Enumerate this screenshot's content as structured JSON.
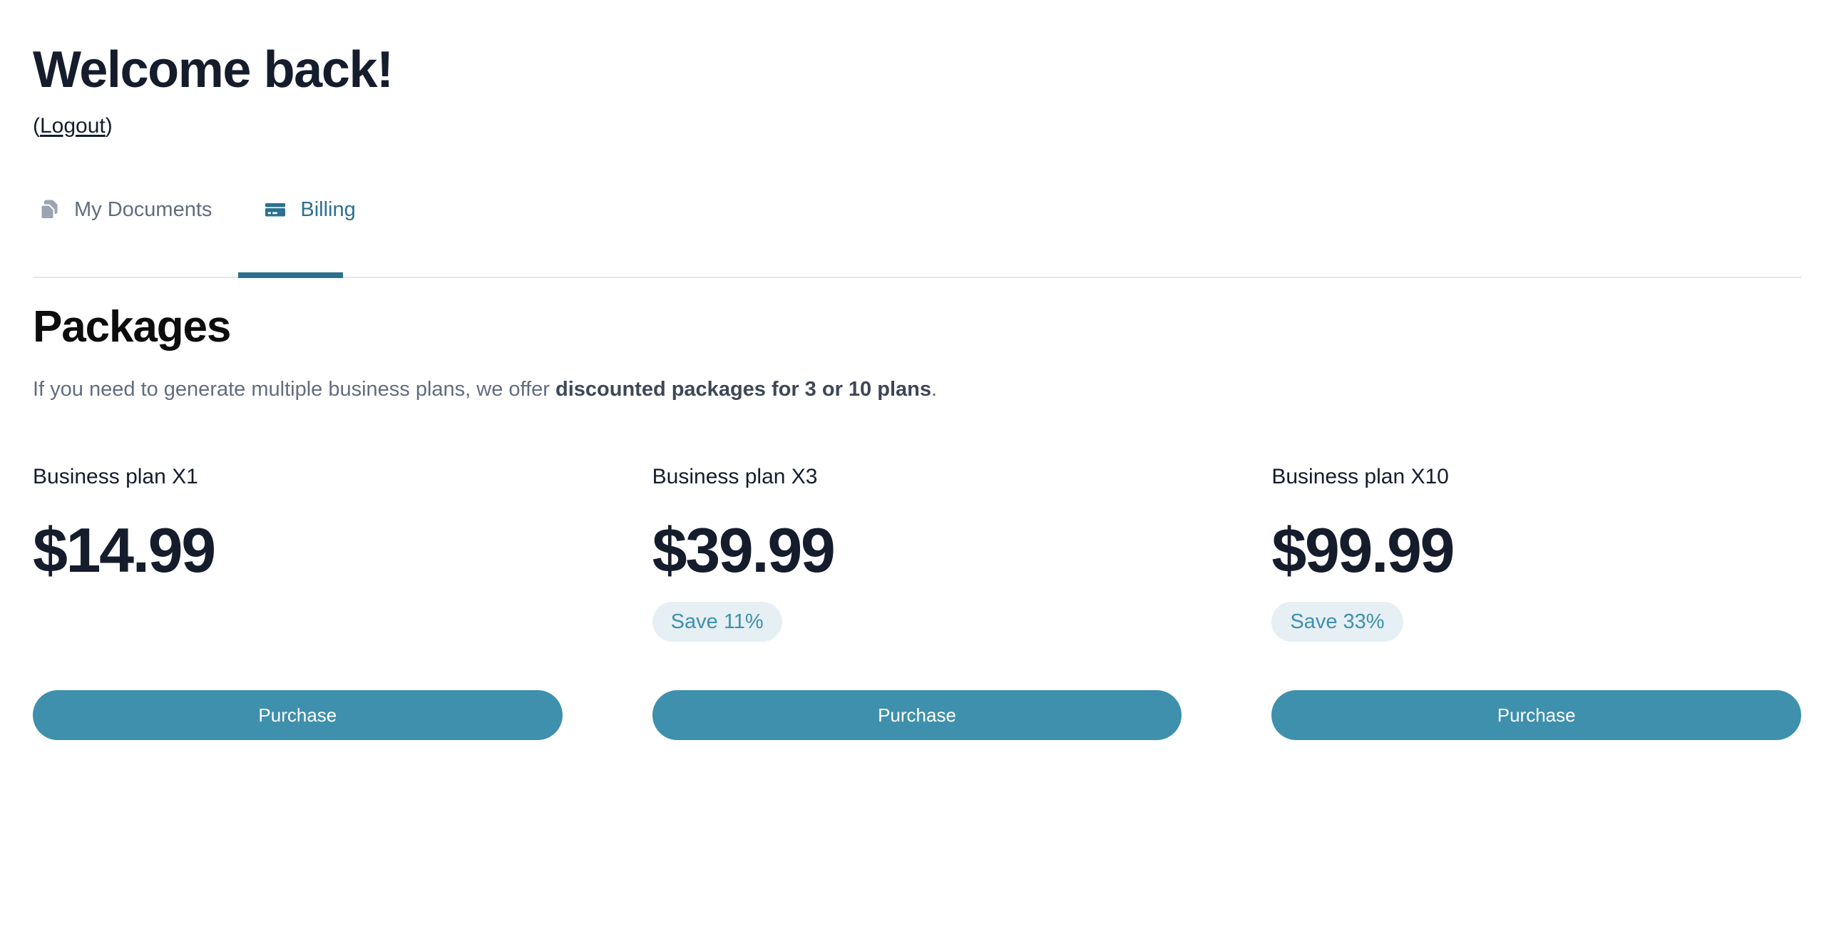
{
  "header": {
    "title": "Welcome back!",
    "logout_open_paren": "(",
    "logout_label": "Logout",
    "logout_close_paren": ")"
  },
  "tabs": [
    {
      "label": "My Documents",
      "icon": "documents-icon",
      "active": false
    },
    {
      "label": "Billing",
      "icon": "credit-card-icon",
      "active": true
    }
  ],
  "packages": {
    "title": "Packages",
    "subtitle_prefix": "If you need to generate multiple business plans, we offer ",
    "subtitle_bold": "discounted packages for 3 or 10 plans",
    "subtitle_suffix": ".",
    "plans": [
      {
        "name": "Business plan X1",
        "price": "$14.99",
        "save_badge": "",
        "button_label": "Purchase"
      },
      {
        "name": "Business plan X3",
        "price": "$39.99",
        "save_badge": "Save 11%",
        "button_label": "Purchase"
      },
      {
        "name": "Business plan X10",
        "price": "$99.99",
        "save_badge": "Save 33%",
        "button_label": "Purchase"
      }
    ]
  },
  "colors": {
    "accent": "#3e90ac",
    "accent_dark": "#2d6f8e",
    "badge_bg": "#e6eff4",
    "heading": "#151c2c",
    "muted_text": "#626c7e",
    "divider": "#e4e7eb",
    "inactive_icon": "#9ba4b2"
  }
}
